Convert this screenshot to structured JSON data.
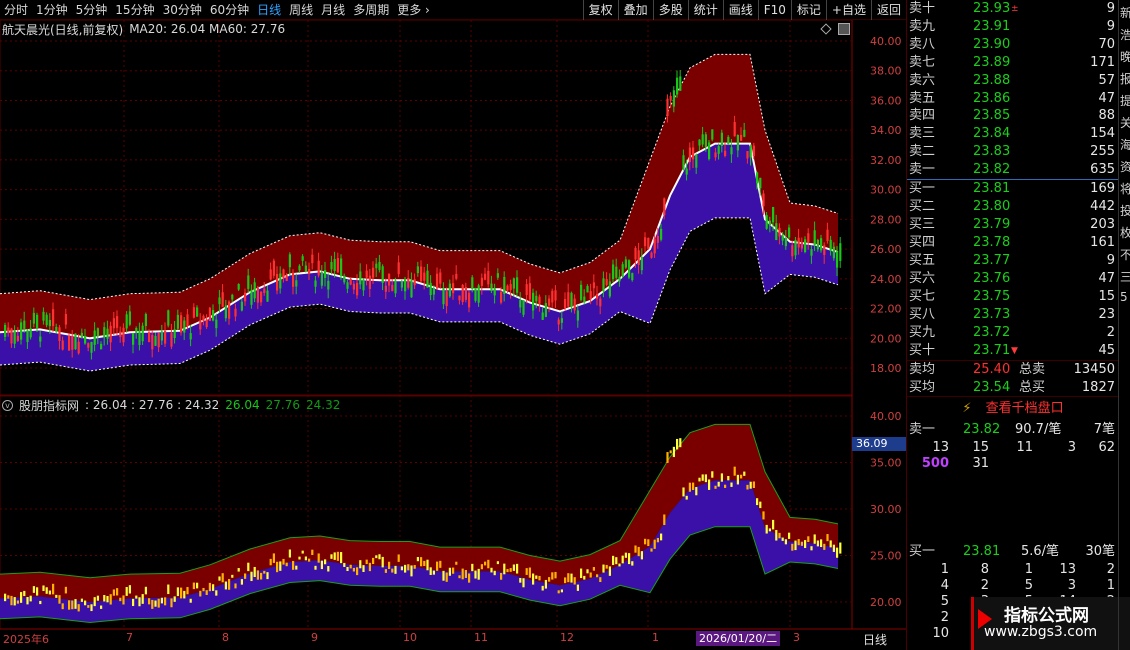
{
  "toolbar": {
    "left_items": [
      "分时",
      "1分钟",
      "5分钟",
      "15分钟",
      "30分钟",
      "60分钟",
      "日线",
      "周线",
      "月线",
      "多周期",
      "更多"
    ],
    "active_item": "日线",
    "more_chevron": "›",
    "right_buttons": [
      "复权",
      "叠加",
      "多股",
      "统计",
      "画线",
      "F10",
      "标记",
      "+自选",
      "返回"
    ]
  },
  "main_panel": {
    "title": "航天晨光(日线,前复权)",
    "ma_values": "MA20: 26.04  MA60: 27.76",
    "y_ticks": [
      "40.00",
      "38.00",
      "36.00",
      "34.00",
      "32.00",
      "30.00",
      "28.00",
      "26.00",
      "24.00",
      "22.00",
      "20.00",
      "18.00"
    ],
    "icons": [
      "diamond-icon",
      "square-icon"
    ]
  },
  "sub_panel": {
    "title": "股朋指标网",
    "values_white": ": 26.04 : 27.76 : 24.32",
    "value_green_1": "26.04",
    "value_green_2": "27.76",
    "value_green_3": "24.32",
    "y_ticks": [
      "40.00",
      "35.00",
      "30.00",
      "25.00",
      "20.00"
    ],
    "crosshair_value": "36.09"
  },
  "x_axis": {
    "labels": [
      "2025年6",
      "7",
      "8",
      "9",
      "10",
      "11",
      "12",
      "1",
      "3"
    ],
    "date_badge": "2026/01/20/二",
    "period": "日线"
  },
  "order_book": {
    "asks": [
      {
        "label": "卖十",
        "price": "23.93",
        "vol": "9",
        "mark": "±"
      },
      {
        "label": "卖九",
        "price": "23.91",
        "vol": "9"
      },
      {
        "label": "卖八",
        "price": "23.90",
        "vol": "70"
      },
      {
        "label": "卖七",
        "price": "23.89",
        "vol": "171"
      },
      {
        "label": "卖六",
        "price": "23.88",
        "vol": "57"
      },
      {
        "label": "卖五",
        "price": "23.86",
        "vol": "47"
      },
      {
        "label": "卖四",
        "price": "23.85",
        "vol": "88"
      },
      {
        "label": "卖三",
        "price": "23.84",
        "vol": "154"
      },
      {
        "label": "卖二",
        "price": "23.83",
        "vol": "255"
      },
      {
        "label": "卖一",
        "price": "23.82",
        "vol": "635"
      }
    ],
    "bids": [
      {
        "label": "买一",
        "price": "23.81",
        "vol": "169"
      },
      {
        "label": "买二",
        "price": "23.80",
        "vol": "442"
      },
      {
        "label": "买三",
        "price": "23.79",
        "vol": "203"
      },
      {
        "label": "买四",
        "price": "23.78",
        "vol": "161"
      },
      {
        "label": "买五",
        "price": "23.77",
        "vol": "9"
      },
      {
        "label": "买六",
        "price": "23.76",
        "vol": "47"
      },
      {
        "label": "买七",
        "price": "23.75",
        "vol": "15"
      },
      {
        "label": "买八",
        "price": "23.73",
        "vol": "23"
      },
      {
        "label": "买九",
        "price": "23.72",
        "vol": "2"
      },
      {
        "label": "买十",
        "price": "23.71",
        "vol": "45",
        "mark": "▼"
      }
    ],
    "sell_avg_label": "卖均",
    "sell_avg_price": "25.40",
    "total_sell_label": "总卖",
    "total_sell": "13450",
    "buy_avg_label": "买均",
    "buy_avg_price": "23.54",
    "total_buy_label": "总买",
    "total_buy": "1827",
    "thousand_btn": "查看千档盘口",
    "sell1_label": "卖一",
    "sell1_price": "23.82",
    "sell1_per": "90.7/笔",
    "sell1_count": "7笔",
    "sell1_queue": [
      "13",
      "15",
      "11",
      "3",
      "62"
    ],
    "sell1_queue2": [
      "500",
      "31"
    ],
    "buy1_label": "买一",
    "buy1_price": "23.81",
    "buy1_per": "5.6/笔",
    "buy1_count": "30笔",
    "buy1_queue": [
      [
        "1",
        "8",
        "1",
        "13",
        "2"
      ],
      [
        "4",
        "2",
        "5",
        "3",
        "1"
      ],
      [
        "5",
        "3",
        "5",
        "14",
        "2"
      ],
      [
        "2",
        "",
        "",
        "",
        ""
      ],
      [
        "10",
        "",
        "",
        "",
        ""
      ]
    ]
  },
  "edge_column": [
    "新",
    "浩",
    "晚",
    "报",
    "提",
    "关",
    "海",
    "资",
    "将",
    "投",
    "枚",
    "不",
    "三",
    "5"
  ],
  "watermark": {
    "title": "指标公式网",
    "url": "www.zbgs3.com"
  },
  "colors": {
    "up": "#ff3030",
    "down": "#19c619",
    "band_upper": "#7a0000",
    "band_lower": "#3a10a8",
    "mid_line": "#ffffff",
    "grid": "#5a0000"
  }
}
